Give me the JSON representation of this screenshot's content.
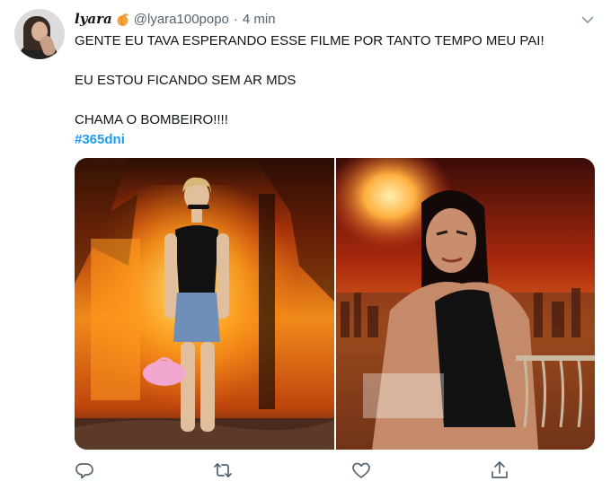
{
  "tweet": {
    "display_name": "lyara",
    "handle": "@lyara100popo",
    "separator": "·",
    "time": "4 min",
    "lines": [
      "GENTE EU TAVA ESPERANDO ESSE FILME POR TANTO TEMPO MEU PAI!",
      "EU ESTOU FICANDO SEM AR MDS",
      "CHAMA O BOMBEIRO!!!!"
    ],
    "hashtag": "#365dni"
  },
  "icons": {
    "name_emoji": "peach-emoji-icon",
    "menu": "chevron-down-icon",
    "reply": "reply-icon",
    "retweet": "retweet-icon",
    "like": "heart-icon",
    "share": "share-icon"
  },
  "colors": {
    "text": "#0f1419",
    "secondary": "#536471",
    "link": "#1d9bf0",
    "icon": "#536471"
  }
}
